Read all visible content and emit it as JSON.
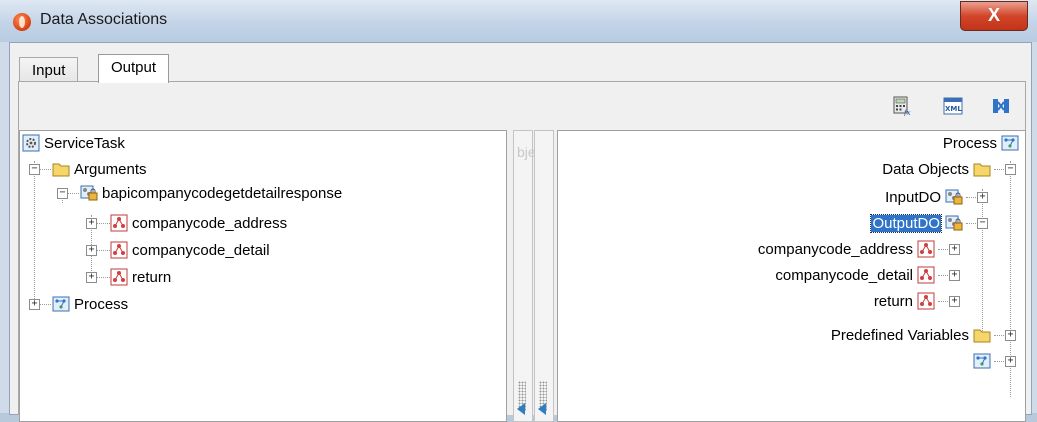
{
  "window": {
    "title": "Data Associations",
    "close_glyph": "X"
  },
  "tabs": [
    {
      "label": "Input",
      "active": false
    },
    {
      "label": "Output",
      "active": true
    }
  ],
  "toolbar": {
    "icons": [
      "calculator-icon",
      "xml-icon",
      "mapping-icon"
    ],
    "xml_glyph": "XML"
  },
  "left_tree": {
    "root": "ServiceTask",
    "arguments": "Arguments",
    "response": "bapicompanycodegetdetailresponse",
    "fields": [
      "companycode_address",
      "companycode_detail",
      "return"
    ],
    "process": "Process"
  },
  "right_tree": {
    "process": "Process",
    "data_objects": "Data Objects",
    "input_do": "InputDO",
    "output_do": "OutputDO",
    "fields": [
      "companycode_address",
      "companycode_detail",
      "return"
    ],
    "predefined": "Predefined Variables"
  },
  "collapsed_glyph": "+",
  "expanded_glyph": "−",
  "ghost_text": "bje",
  "colors": {
    "selection": "#2f74c9",
    "accent": "#2f7ec2",
    "close": "#c13418"
  }
}
